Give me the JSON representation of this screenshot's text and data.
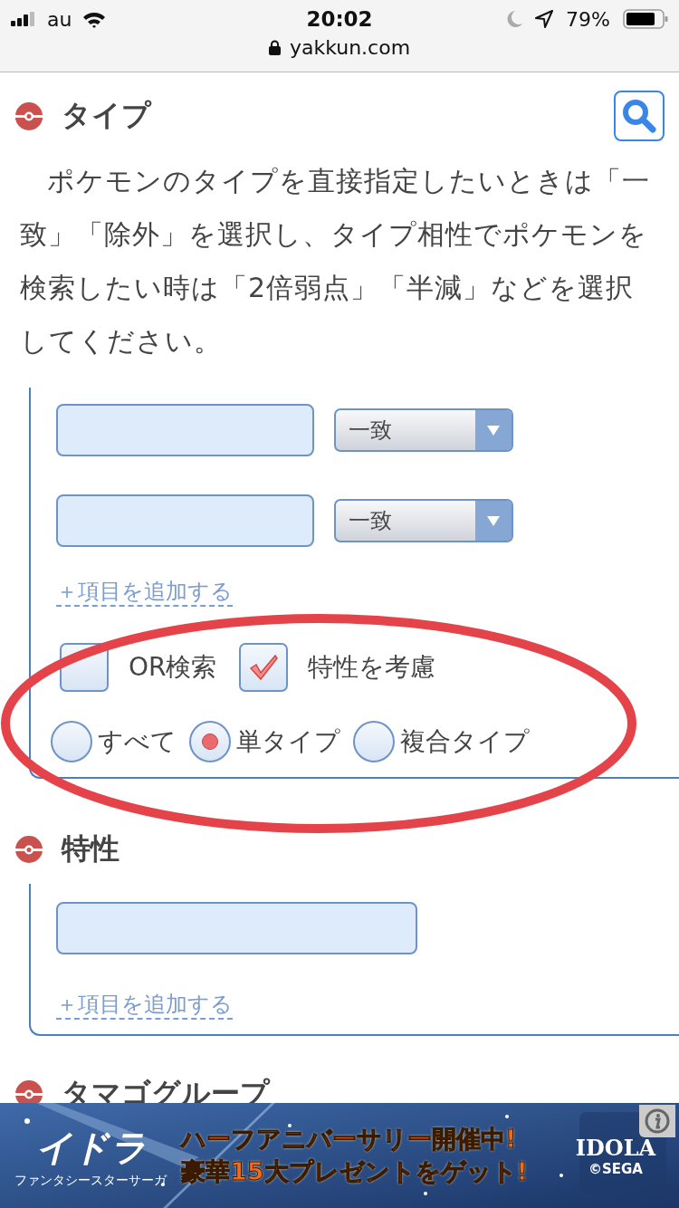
{
  "status_bar": {
    "carrier": "au",
    "time": "20:02",
    "battery": "79%",
    "url": "yakkun.com"
  },
  "type_section": {
    "title": "タイプ",
    "description": "ポケモンのタイプを直接指定したいときは「一致」「除外」を選択し、タイプ相性でポケモンを検索したい時は「2倍弱点」「半減」などを選択してください。",
    "fields": [
      {
        "select": "一致"
      },
      {
        "select": "一致"
      }
    ],
    "add_link": "＋項目を追加する",
    "checkboxes": [
      {
        "label": "OR検索",
        "checked": false
      },
      {
        "label": "特性を考慮",
        "checked": true
      }
    ],
    "radios": [
      {
        "label": "すべて",
        "selected": false
      },
      {
        "label": "単タイプ",
        "selected": true
      },
      {
        "label": "複合タイプ",
        "selected": false
      }
    ]
  },
  "ability_section": {
    "title": "特性",
    "add_link": "＋項目を追加する"
  },
  "egg_section": {
    "title": "タマゴグループ"
  },
  "ad_banner": {
    "kind": "picture",
    "title": "イドラ",
    "subtitle": "ファンタシースターサーガ",
    "line_1": "ハーフアニバーサリー開催中!",
    "line_2": "豪華15大プレゼントをゲット!",
    "logo": "IDOLA",
    "copyright": "©SEGA"
  },
  "annotation": {
    "kind": "ellipse"
  }
}
